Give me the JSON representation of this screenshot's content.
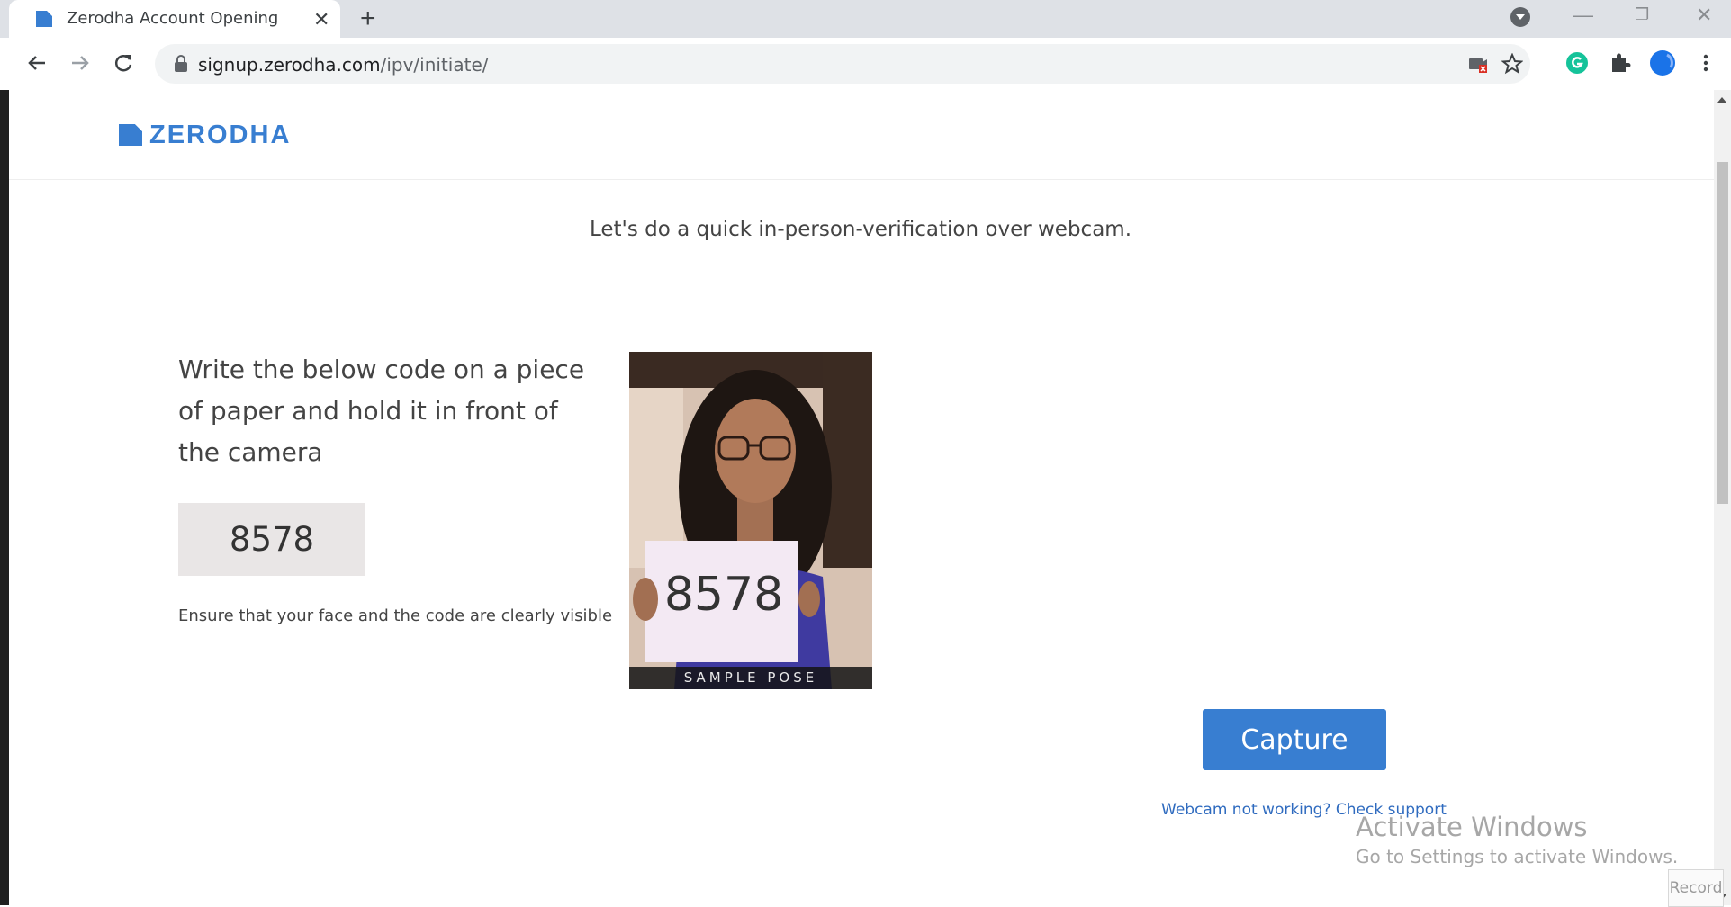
{
  "browser": {
    "tab_title": "Zerodha Account Opening",
    "url_host": "signup.zerodha.com",
    "url_path": "/ipv/initiate/"
  },
  "header": {
    "logo_text": "ZERODHA"
  },
  "main": {
    "intro": "Let's do a quick in-person-verification over webcam.",
    "instruction": "Write the below code on a piece of paper and hold it in front of the camera",
    "code": "8578",
    "hint": "Ensure that your face and the code are clearly visible",
    "sample_code": "8578",
    "sample_caption": "SAMPLE POSE",
    "capture_label": "Capture",
    "support_link": "Webcam not working? Check support"
  },
  "overlay": {
    "activate_title": "Activate Windows",
    "activate_sub": "Go to Settings to activate Windows.",
    "record_label": "Record"
  },
  "colors": {
    "brand": "#387ed1",
    "link": "#2f6bbf",
    "code_bg": "#e9e6e6"
  },
  "icons": [
    "zerodha-favicon-icon",
    "close-icon",
    "plus-icon",
    "back-arrow-icon",
    "forward-arrow-icon",
    "reload-icon",
    "lock-icon",
    "camera-blocked-icon",
    "star-icon",
    "grammarly-icon",
    "extensions-puzzle-icon",
    "profile-avatar-icon",
    "more-vert-icon"
  ]
}
